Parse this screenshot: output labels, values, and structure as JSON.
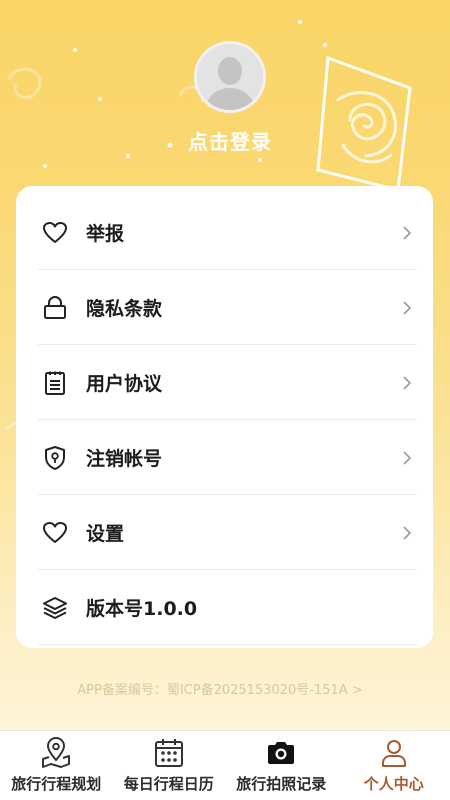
{
  "profile": {
    "login_text": "点击登录"
  },
  "menu": [
    {
      "label": "举报",
      "icon": "heart-icon",
      "has_chevron": true
    },
    {
      "label": "隐私条款",
      "icon": "lock-icon",
      "has_chevron": true
    },
    {
      "label": "用户协议",
      "icon": "clipboard-icon",
      "has_chevron": true
    },
    {
      "label": "注销帐号",
      "icon": "shield-key-icon",
      "has_chevron": true
    },
    {
      "label": "设置",
      "icon": "heart-icon",
      "has_chevron": true
    },
    {
      "label": "版本号1.0.0",
      "icon": "layers-icon",
      "has_chevron": false
    }
  ],
  "footer": {
    "icp": "APP备案编号：蜀ICP备2025153020号-151A >"
  },
  "tabs": [
    {
      "label": "旅行行程规划",
      "icon": "map-pin-icon",
      "active": false
    },
    {
      "label": "每日行程日历",
      "icon": "calendar-icon",
      "active": false
    },
    {
      "label": "旅行拍照记录",
      "icon": "camera-icon",
      "active": false
    },
    {
      "label": "个人中心",
      "icon": "user-icon",
      "active": true
    }
  ],
  "colors": {
    "accent": "#a35c2e",
    "bg_top": "#f9d566",
    "bg_bottom": "#fff7e2"
  }
}
